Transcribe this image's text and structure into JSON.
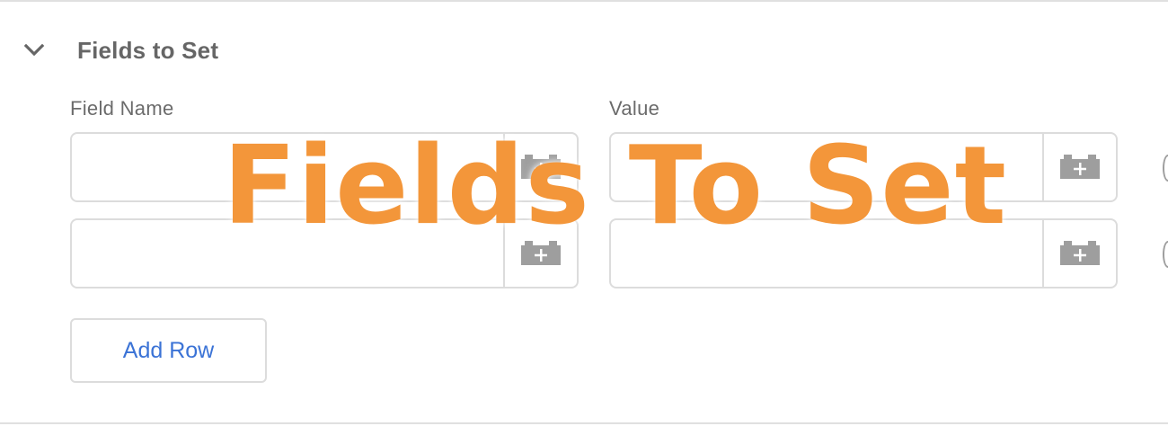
{
  "section": {
    "title": "Fields to Set",
    "expand_icon": "chevron-down-icon"
  },
  "columns": {
    "field_name_label": "Field Name",
    "value_label": "Value"
  },
  "rows": [
    {
      "field_name": "",
      "value": ""
    },
    {
      "field_name": "",
      "value": ""
    }
  ],
  "variable_icon": "variable-brick-plus-icon",
  "add_row_label": "Add Row",
  "overlay_text": "Fields To Set",
  "colors": {
    "section_title": "#666666",
    "border": "#dcdcdc",
    "icon_gray": "#9e9e9e",
    "link_blue": "#3b73d6",
    "overlay_orange": "#f3963a"
  }
}
